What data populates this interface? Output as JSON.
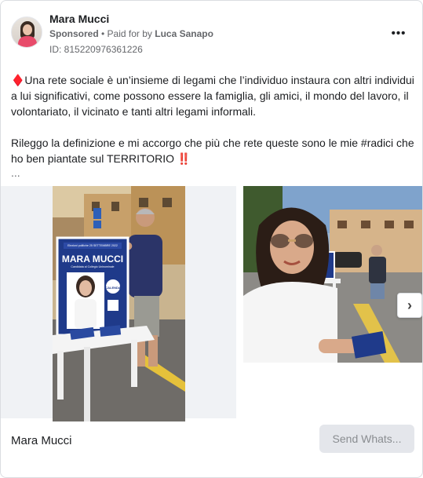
{
  "header": {
    "page_name": "Mara Mucci",
    "sponsored": "Sponsored",
    "paid_for_by_prefix": " • Paid for by ",
    "payer": "Luca Sanapo",
    "ad_id": "ID: 815220976361226",
    "more_label": "•••"
  },
  "post": {
    "paragraph1": "♦️Una rete sociale è un’insieme di legami che l’individuo instaura con altri individui a lui significativi, come possono essere la famiglia, gli amici, il mondo del lavoro, il volontariato, il vicinato e tanti altri legami informali.",
    "paragraph2": "Rileggo la definizione e mi accorgo che più che rete queste sono le mie #radici che ho ben piantate sul TERRITORIO ‼️",
    "ellipsis": "..."
  },
  "poster": {
    "date_line": "Elezioni politiche 25 SETTEMBRE 2022",
    "role_line": "Candidata al Collegio Uninominale",
    "candidate": "MARA MUCCI",
    "party": "CALENDA"
  },
  "carousel": {
    "next_label": "›"
  },
  "footer": {
    "name": "Mara Mucci",
    "cta_label": "Send Whats..."
  }
}
